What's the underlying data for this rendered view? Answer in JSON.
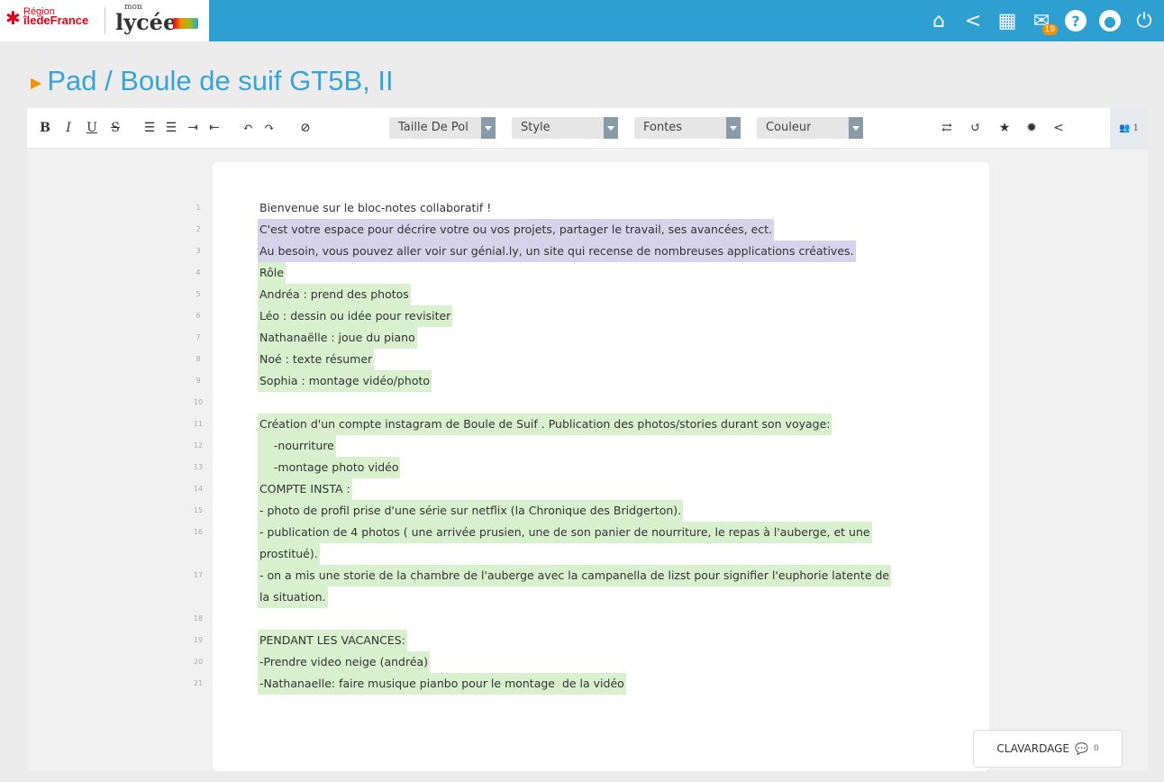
{
  "header": {
    "region_line1": "Région",
    "region_line2": "îledeFrance",
    "brand_mon": "mon",
    "brand_lycee": "lycée",
    "mail_count": "19"
  },
  "page": {
    "title": "Pad / Boule de suif GT5B, II"
  },
  "toolbar": {
    "bold": "B",
    "italic": "I",
    "underline": "U",
    "strike": "S",
    "font_size_select": "Taille De Pol",
    "style_select": "Style",
    "fonts_select": "Fontes",
    "color_select": "Couleur",
    "users_count": "1"
  },
  "lines": [
    {
      "n": "1",
      "text": "Bienvenue sur le bloc-notes collaboratif !",
      "hl": ""
    },
    {
      "n": "2",
      "text": "C'est votre espace pour décrire votre ou vos projets, partager le travail, ses avancées, ect.",
      "hl": "p"
    },
    {
      "n": "3",
      "text": "Au besoin, vous pouvez aller voir sur génial.ly, un site qui recense de nombreuses applications créatives.",
      "hl": "p"
    },
    {
      "n": "4",
      "text": "Rôle",
      "hl": "g"
    },
    {
      "n": "5",
      "text": "Andréa : prend des photos",
      "hl": "g"
    },
    {
      "n": "6",
      "text": "Léo : dessin ou idée pour revisiter",
      "hl": "g"
    },
    {
      "n": "7",
      "text": "Nathanaëlle : joue du piano",
      "hl": "g"
    },
    {
      "n": "8",
      "text": "Noé : texte résumer",
      "hl": "g"
    },
    {
      "n": "9",
      "text": "Sophia : montage vidéo/photo",
      "hl": "g"
    },
    {
      "n": "10",
      "text": "",
      "hl": ""
    },
    {
      "n": "11",
      "text": "Création d'un compte instagram de Boule de Suif . Publication des photos/stories durant son voyage:",
      "hl": "g"
    },
    {
      "n": "12",
      "text": "    -nourriture",
      "hl": "g"
    },
    {
      "n": "13",
      "text": "    -montage photo vidéo",
      "hl": "g"
    },
    {
      "n": "14",
      "text": "COMPTE INSTA :",
      "hl": "g"
    },
    {
      "n": "15",
      "text": "- photo de profil prise d'une série sur netflix (la Chronique des Bridgerton).",
      "hl": "g"
    },
    {
      "n": "16",
      "text": "- publication de 4 photos ( une arrivée prusien, une de son panier de nourriture, le repas à l'auberge, et une",
      "hl": "g"
    },
    {
      "n": "",
      "text": "prostitué).",
      "hl": "g"
    },
    {
      "n": "17",
      "text": "- on a mis une storie de la chambre de l'auberge avec la campanella de lizst pour signifier l'euphorie latente de",
      "hl": "g"
    },
    {
      "n": "",
      "text": "la situation.",
      "hl": "g"
    },
    {
      "n": "18",
      "text": "",
      "hl": ""
    },
    {
      "n": "19",
      "text": "PENDANT LES VACANCES:",
      "hl": "g"
    },
    {
      "n": "20",
      "text": "-Prendre video neige (andréa)",
      "hl": "g"
    },
    {
      "n": "21",
      "text": "-Nathanaelle: faire musique pianbo pour le montage  de la vidéo",
      "hl": "g"
    }
  ],
  "chat": {
    "label": "CLAVARDAGE",
    "count": "0"
  }
}
